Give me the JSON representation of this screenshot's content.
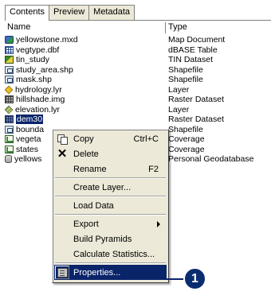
{
  "tabs": [
    "Contents",
    "Preview",
    "Metadata"
  ],
  "columns": {
    "name": "Name",
    "type": "Type"
  },
  "rows": [
    {
      "name": "yellowstone.mxd",
      "type": "Map Document",
      "icon": "map-document-icon"
    },
    {
      "name": "vegtype.dbf",
      "type": "dBASE Table",
      "icon": "dbase-table-icon"
    },
    {
      "name": "tin_study",
      "type": "TIN Dataset",
      "icon": "tin-dataset-icon"
    },
    {
      "name": "study_area.shp",
      "type": "Shapefile",
      "icon": "shapefile-icon"
    },
    {
      "name": "mask.shp",
      "type": "Shapefile",
      "icon": "shapefile-icon"
    },
    {
      "name": "hydrology.lyr",
      "type": "Layer",
      "icon": "layer-icon"
    },
    {
      "name": "hillshade.img",
      "type": "Raster Dataset",
      "icon": "raster-img-icon"
    },
    {
      "name": "elevation.lyr",
      "type": "Layer",
      "icon": "layer-icon"
    },
    {
      "name": "dem30",
      "type": "Raster Dataset",
      "icon": "raster-dataset-icon"
    },
    {
      "name": "bounda",
      "type": "Shapefile",
      "icon": "shapefile-icon"
    },
    {
      "name": "vegeta",
      "type": "Coverage",
      "icon": "coverage-icon"
    },
    {
      "name": "states",
      "type": "Coverage",
      "icon": "coverage-icon"
    },
    {
      "name": "yellows",
      "type": "Personal Geodatabase",
      "icon": "geodatabase-icon"
    }
  ],
  "context_menu": {
    "copy": {
      "label": "Copy",
      "shortcut": "Ctrl+C"
    },
    "delete": {
      "label": "Delete"
    },
    "rename": {
      "label": "Rename",
      "shortcut": "F2"
    },
    "create_layer": {
      "label": "Create Layer..."
    },
    "load_data": {
      "label": "Load Data"
    },
    "export": {
      "label": "Export"
    },
    "build_pyramids": {
      "label": "Build Pyramids"
    },
    "calculate_statistics": {
      "label": "Calculate Statistics..."
    },
    "properties": {
      "label": "Properties..."
    }
  },
  "callout": {
    "number": "1"
  },
  "colors": {
    "selection": "#0a246a",
    "menu_bg": "#ece9d8",
    "callout": "#0a2d6f"
  }
}
